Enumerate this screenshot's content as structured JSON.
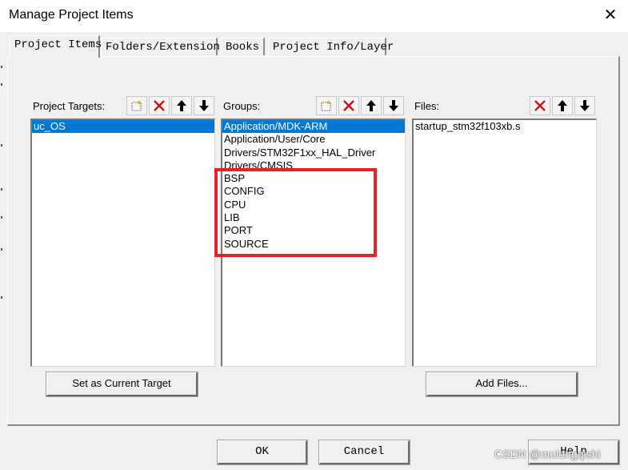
{
  "window": {
    "title": "Manage Project Items",
    "close_symbol": "✕"
  },
  "tabs": [
    {
      "label": "Project Items",
      "active": true
    },
    {
      "label": "Folders/Extensions",
      "active": false
    },
    {
      "label": "Books",
      "active": false
    },
    {
      "label": "Project Info/Layer",
      "active": false
    }
  ],
  "targets": {
    "label": "Project Targets:",
    "items": [
      "uc_OS"
    ],
    "selected": 0
  },
  "groups": {
    "label": "Groups:",
    "items": [
      "Application/MDK-ARM",
      "Application/User/Core",
      "Drivers/STM32F1xx_HAL_Driver",
      "Drivers/CMSIS",
      "BSP",
      "CONFIG",
      "CPU",
      "LIB",
      "PORT",
      "SOURCE"
    ],
    "selected": 0
  },
  "files": {
    "label": "Files:",
    "items": [
      "startup_stm32f103xb.s"
    ]
  },
  "buttons": {
    "set_target": "Set as Current Target",
    "add_files": "Add Files...",
    "ok": "OK",
    "cancel": "Cancel",
    "help": "Help"
  },
  "colors": {
    "selection": "#0078d7",
    "highlight_box": "#e8202a"
  },
  "watermark": "CSDN @molongqishi"
}
